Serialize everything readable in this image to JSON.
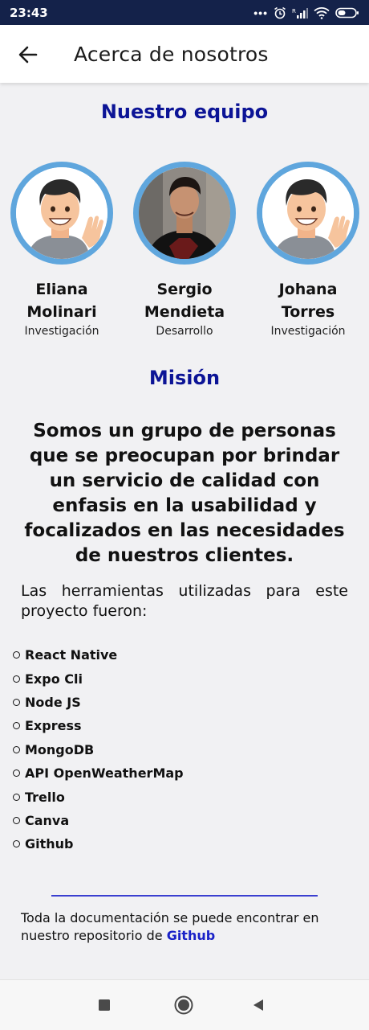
{
  "status_bar": {
    "time": "23:43",
    "icons": [
      "more-dots-icon",
      "alarm-icon",
      "signal-icon",
      "wifi-icon",
      "battery-icon"
    ]
  },
  "header": {
    "title": "Acerca de nosotros",
    "back_icon": "arrow-left-icon"
  },
  "team": {
    "title": "Nuestro equipo",
    "members": [
      {
        "first": "Eliana",
        "last": "Molinari",
        "role": "Investigación",
        "avatar": "cartoon-avatar"
      },
      {
        "first": "Sergio",
        "last": "Mendieta",
        "role": "Desarrollo",
        "avatar": "photo-avatar"
      },
      {
        "first": "Johana",
        "last": "Torres",
        "role": "Investigación",
        "avatar": "cartoon-avatar"
      }
    ]
  },
  "mission": {
    "title": "Misión",
    "text": "Somos un grupo de personas que se preocupan por brindar un servicio de calidad con enfasis en la usabilidad y focalizados en las necesidades de nuestros clientes."
  },
  "tools": {
    "intro": "Las herramientas utilizadas para este proyecto fueron:",
    "items": [
      "React Native",
      "Expo Cli",
      "Node JS",
      "Express",
      "MongoDB",
      "API OpenWeatherMap",
      "Trello",
      "Canva",
      "Github"
    ]
  },
  "footer": {
    "text": "Toda la documentación se puede encontrar en nuestro repositorio de ",
    "link": "Github"
  },
  "colors": {
    "accent": "#0c1496",
    "avatar_ring": "#5fa6dd",
    "status_bar": "#14224a",
    "link": "#1a22c8"
  },
  "nav_bar": {
    "buttons": [
      "recents-square-icon",
      "home-circle-icon",
      "back-triangle-icon"
    ]
  }
}
